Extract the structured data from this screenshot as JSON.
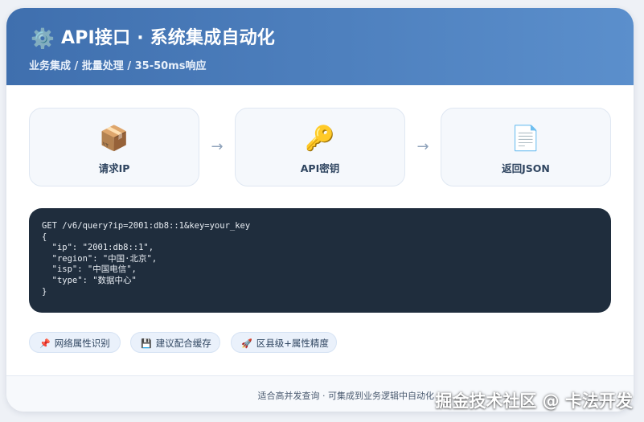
{
  "header": {
    "icon": "gear-icon",
    "title": "API接口 · 系统集成自动化",
    "subtitle": "业务集成 / 批量处理 / 35-50ms响应"
  },
  "flow": {
    "steps": [
      {
        "icon": "package-icon",
        "label": "请求IP"
      },
      {
        "icon": "key-icon",
        "label": "API密钥"
      },
      {
        "icon": "document-icon",
        "label": "返回JSON"
      }
    ],
    "arrow": "→"
  },
  "code": {
    "lines": [
      "GET /v6/query?ip=2001:db8::1&key=your_key",
      "{",
      "  \"ip\": \"2001:db8::1\",",
      "  \"region\": \"中国·北京\",",
      "  \"isp\": \"中国电信\",",
      "  \"type\": \"数据中心\"",
      "}"
    ]
  },
  "chips": [
    {
      "icon": "pin-icon",
      "label": "网络属性识别"
    },
    {
      "icon": "save-icon",
      "label": "建议配合缓存"
    },
    {
      "icon": "rocket-icon",
      "label": "区县级+属性精度"
    }
  ],
  "footer": {
    "text": "适合高并发查询 · 可集成到业务逻辑中自动化"
  },
  "watermark": "掘金技术社区 @ 卡法开发"
}
